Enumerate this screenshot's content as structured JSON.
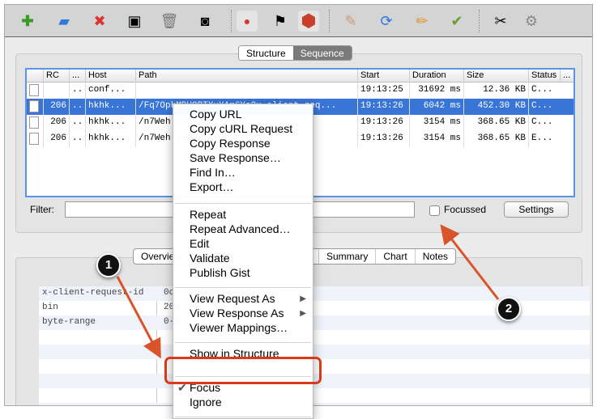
{
  "toolbar": {
    "icons": [
      "new-session-icon",
      "open-icon",
      "close-session-icon",
      "save-icon",
      "trash-icon",
      "binoculars-icon",
      "record-icon",
      "checkered-flag-icon",
      "stop-icon",
      "edit-document-icon",
      "refresh-icon",
      "pencil-icon",
      "checkmark-icon",
      "tools-icon",
      "gear-icon"
    ]
  },
  "view_switch": {
    "structure": "Structure",
    "sequence": "Sequence",
    "selected": "Sequence"
  },
  "table": {
    "columns": [
      "RC",
      "...",
      "Host",
      "Path",
      "Start",
      "Duration",
      "Size",
      "Status",
      "..."
    ],
    "rows": [
      {
        "rc": "",
        "dots": "..",
        "host": "conf...",
        "path": "",
        "start": "19:13:25",
        "duration": "31692 ms",
        "size": "12.36 KB",
        "status": "C..."
      },
      {
        "rc": "206",
        "dots": "..",
        "host": "hkhk...",
        "path": "/Fq7OpkMBUOBTXxYAm6Ya?x-client-req...",
        "start": "19:13:26",
        "duration": "6042 ms",
        "size": "452.30 KB",
        "status": "C...",
        "selected": true
      },
      {
        "rc": "206",
        "dots": "..",
        "host": "hkhk...",
        "path": "/n7Weh                  req...",
        "start": "19:13:26",
        "duration": "3154 ms",
        "size": "368.65 KB",
        "status": "C..."
      },
      {
        "rc": "206",
        "dots": "..",
        "host": "hkhk...",
        "path": "/n7Weh                  req...",
        "start": "19:13:26",
        "duration": "3154 ms",
        "size": "368.65 KB",
        "status": "E..."
      }
    ]
  },
  "filter": {
    "label": "Filter:",
    "value": "",
    "focussed_label": "Focussed",
    "focussed_checked": false,
    "settings_label": "Settings"
  },
  "detail_tabs": [
    "Overview",
    "Summary",
    "Chart",
    "Notes"
  ],
  "detail_rows": [
    {
      "key": "x-client-request-id",
      "value": "0ca                    dd652e88e"
    },
    {
      "key": "bin",
      "value": "204"
    },
    {
      "key": "byte-range",
      "value": "0-4"
    }
  ],
  "context_menu": {
    "groups": [
      [
        "Copy URL",
        "Copy cURL Request",
        "Copy Response",
        "Save Response…",
        "Find In…",
        "Export…"
      ],
      [
        "Repeat",
        "Repeat Advanced…",
        "Edit",
        "Validate",
        "Publish Gist"
      ],
      [
        "View Request As",
        "View Response As",
        "Viewer Mappings…"
      ],
      [
        "Show in Structure"
      ],
      [
        "Focus",
        "Ignore"
      ]
    ],
    "submenu_items": [
      "View Request As",
      "View Response As"
    ],
    "checked_item": "Focus",
    "check_glyph": "✔",
    "submenu_glyph": "▶"
  },
  "callouts": [
    "1",
    "2"
  ],
  "colors": {
    "selection": "#3875d7",
    "highlight": "#d9391a",
    "arrow": "#d9532b"
  }
}
